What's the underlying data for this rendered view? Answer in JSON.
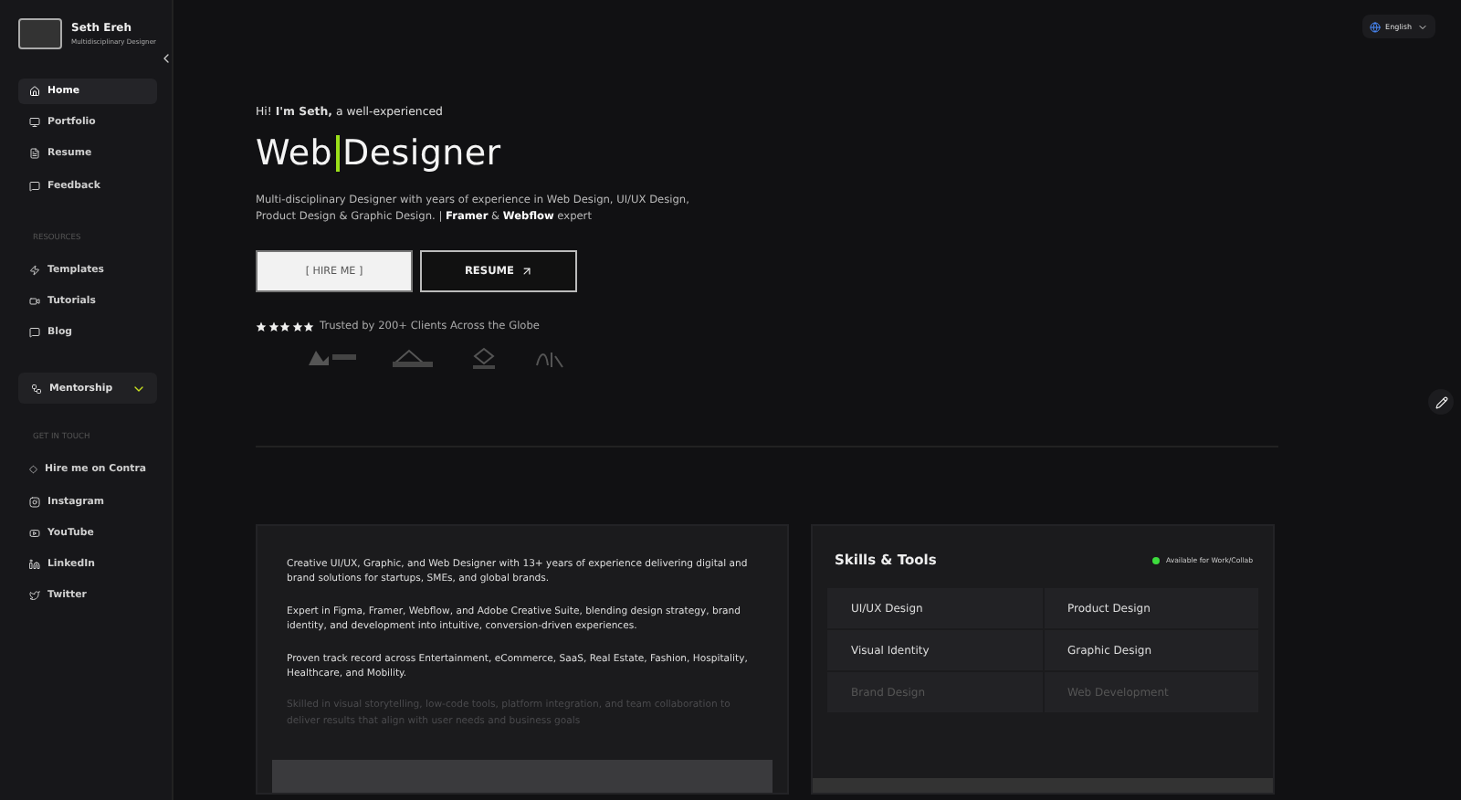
{
  "profile": {
    "name": "Seth Ereh",
    "role": "Multidisciplinary Designer"
  },
  "nav": [
    {
      "label": "Home",
      "selected": true
    },
    {
      "label": "Portfolio",
      "selected": false
    },
    {
      "label": "Resume",
      "selected": false
    },
    {
      "label": "Feedback",
      "selected": false
    }
  ],
  "resources": {
    "heading": "RESOURCES",
    "items": [
      {
        "label": "Templates",
        "selected": false
      },
      {
        "label": "Tutorials",
        "selected": false
      },
      {
        "label": "Blog",
        "selected": false
      }
    ]
  },
  "mentorship": {
    "label": "Mentorship",
    "expanded": false
  },
  "contact": {
    "heading": "GET IN TOUCH",
    "items": [
      {
        "label": "Hire me on Contra",
        "selected": false
      },
      {
        "label": "Instagram",
        "selected": false
      },
      {
        "label": "YouTube",
        "selected": false
      },
      {
        "label": "LinkedIn",
        "selected": false
      },
      {
        "label": "Twitter",
        "selected": false
      }
    ]
  },
  "language": "English",
  "hero": {
    "greeting": "Hi! **I'm Seth,** a well-experienced",
    "title_first": "Web",
    "title_second": "Designer",
    "intro": "Multi-disciplinary Designer with years of experience in Web Design, UI/UX Design, Product Design & Graphic Design.  |  **Framer** & **Webflow** expert",
    "primary_button": "[ HIRE ME ]",
    "secondary_button": "RESUME",
    "stars": 5,
    "trust": "Trusted by 200+ Clients Across the Globe"
  },
  "about": [
    "Creative UI/UX, Graphic, and Web Designer with 13+ years of experience delivering digital and brand solutions for startups, SMEs, and global brands.",
    "Expert in Figma, Framer, Webflow, and Adobe Creative Suite, blending design strategy, brand identity, and development into intuitive, conversion-driven experiences.",
    "Proven track record across Entertainment, eCommerce, SaaS, Real Estate, Fashion, Hospitality, Healthcare, and Mobility.",
    "Skilled in visual storytelling, low-code tools, platform integration, and team collaboration to deliver results that align with user needs and business goals"
  ],
  "skills": {
    "title": "Skills & Tools",
    "status": "Available for Work/Collab",
    "items": [
      "UI/UX Design",
      "Product Design",
      "Visual Identity",
      "Graphic Design",
      "Brand Design",
      "Web Development"
    ]
  }
}
